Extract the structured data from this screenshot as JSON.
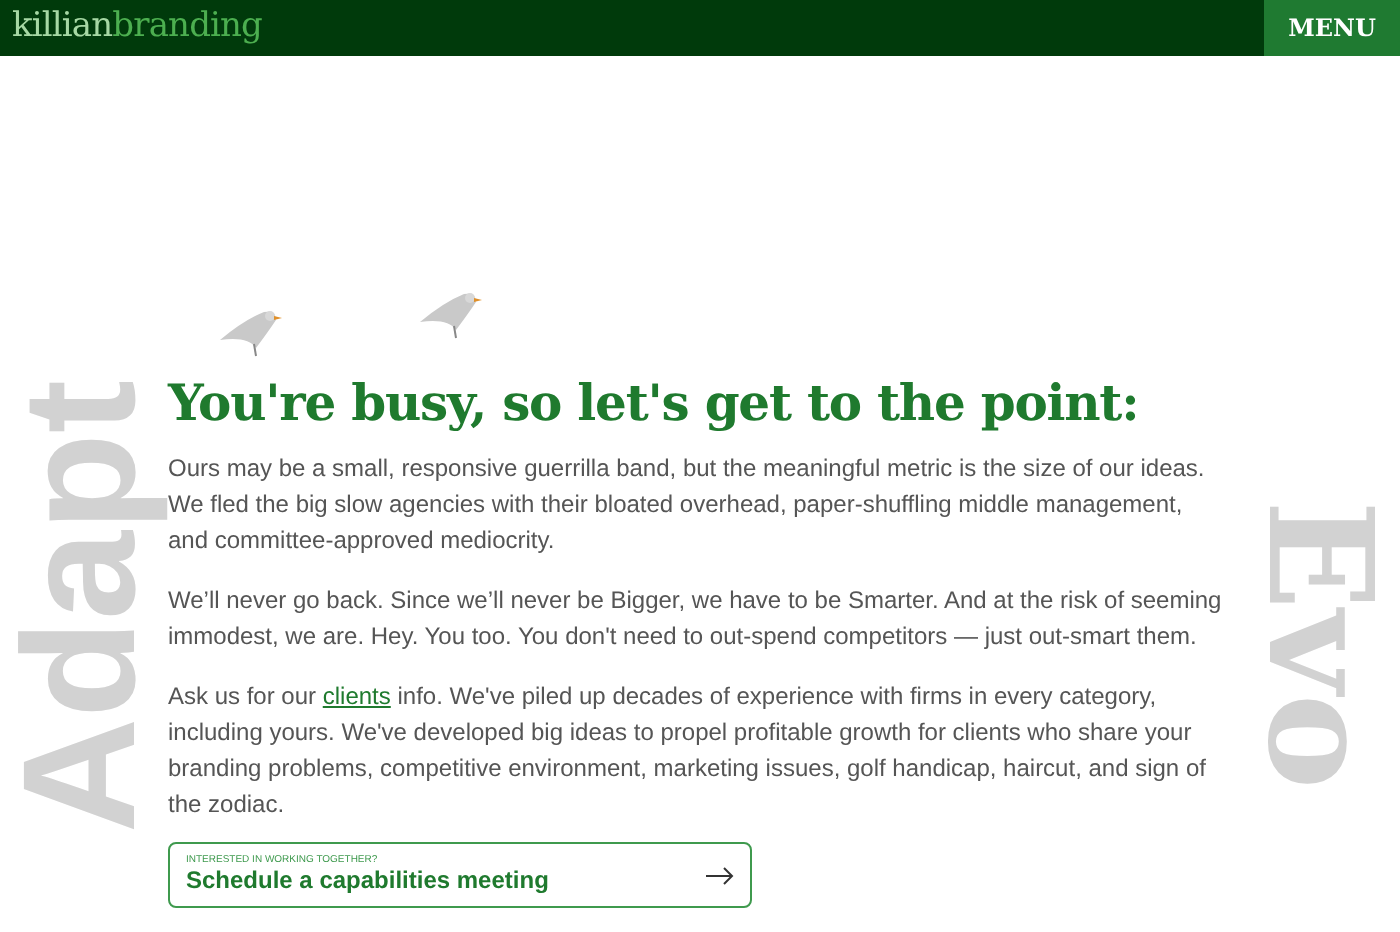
{
  "header": {
    "logo_part_1": "killian",
    "logo_part_2": "branding",
    "menu_button": "MENU"
  },
  "background_words": {
    "left": "Adapt",
    "right": "Evo"
  },
  "heading": "You're busy, so let's get to the point:",
  "paragraphs": [
    "Ours may be a small, responsive guerrilla band, but the meaningful metric is the size of our ideas. We fled the big slow agencies with their bloated overhead, paper-shuffling middle management, and committee-approved mediocrity.",
    "We’ll never go back. Since we’ll never be Bigger, we have to be Smarter. And at the risk of seeming immodest, we are. Hey. You too. You don't need to out-spend competitors — just out-smart them."
  ],
  "clients_paragraph": {
    "before": "Ask us for our ",
    "link": "clients",
    "after": " info. We've piled up decades of experience with firms in every category, including yours. We've developed big ideas to propel profitable growth for clients who share your branding problems, competitive environment, marketing issues, golf handicap, haircut, and sign of the zodiac."
  },
  "cta": {
    "eyebrow": "INTERESTED IN WORKING TOGETHER?",
    "label": "Schedule a capabilities meeting"
  }
}
